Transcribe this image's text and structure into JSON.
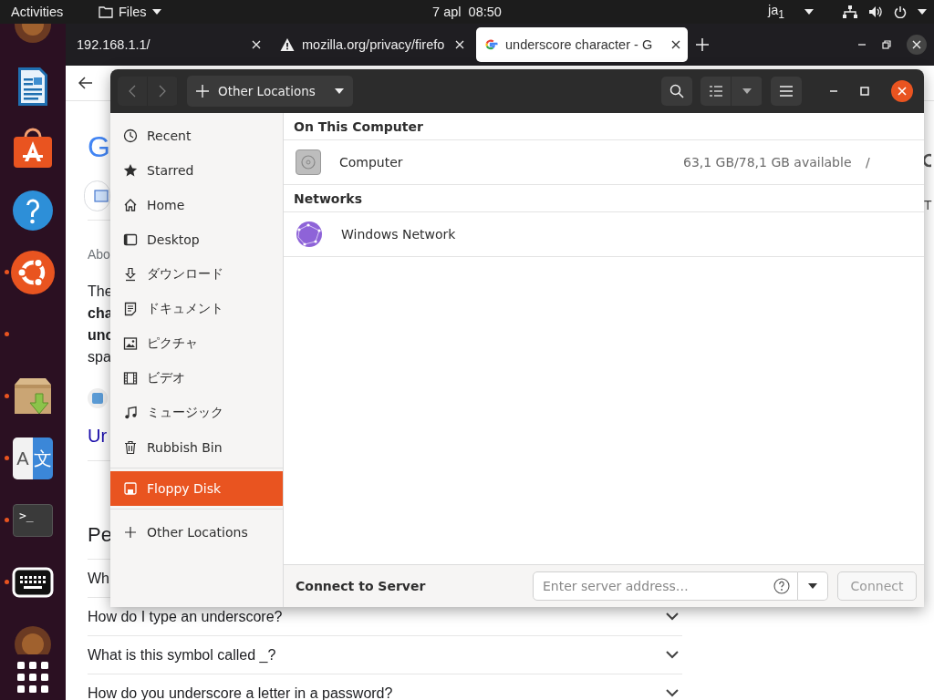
{
  "top_bar": {
    "activities": "Activities",
    "app_menu": "Files",
    "clock": "7 apl  08:50",
    "input_source": "ja$_{1}$"
  },
  "dock": {
    "items": [
      {
        "kind": "partial",
        "running": false
      },
      {
        "kind": "writer",
        "running": false
      },
      {
        "kind": "store",
        "running": false
      },
      {
        "kind": "help",
        "running": false
      },
      {
        "kind": "ubuntu",
        "running": true
      },
      {
        "kind": "empty",
        "running": true
      },
      {
        "kind": "archive",
        "running": true
      },
      {
        "kind": "translate",
        "running": true,
        "glyphs": [
          "A",
          "文"
        ]
      },
      {
        "kind": "terminal",
        "running": true,
        "glyphs": [
          ">_"
        ]
      },
      {
        "kind": "keyboard",
        "running": true
      },
      {
        "kind": "partial",
        "running": false
      }
    ]
  },
  "browser": {
    "tabs": [
      {
        "title": "192.168.1.1/",
        "kind": "plain",
        "selected": false
      },
      {
        "title": "mozilla.org/privacy/firefo",
        "kind": "warning",
        "selected": false
      },
      {
        "title": "underscore character - G",
        "kind": "google",
        "selected": true
      }
    ],
    "logo_fragment": "G",
    "about_fragment": "Abo",
    "snippet_lines": [
      {
        "text": "The",
        "bold": false
      },
      {
        "text": "cha",
        "bold": true
      },
      {
        "text": "unc",
        "bold": true
      },
      {
        "text": "spa",
        "bold": false
      }
    ],
    "link_fragment": "Ur",
    "heading_fragment": "Pe",
    "right_fragment": "T",
    "faq": [
      {
        "text": "Wh",
        "kind": "fragment"
      },
      {
        "text": "How do I type an underscore?",
        "kind": "question"
      },
      {
        "text": "What is this symbol called _?",
        "kind": "question"
      },
      {
        "text": "How do you underscore a letter in a password?",
        "kind": "question"
      }
    ]
  },
  "files": {
    "nav_buttons": [
      {
        "kind": "back",
        "disabled": true
      },
      {
        "kind": "forward",
        "disabled": true
      }
    ],
    "path": "Other Locations",
    "sidebar_sections": [
      {
        "items": [
          {
            "kind": "recent",
            "label": "Recent",
            "selected": false
          },
          {
            "kind": "starred",
            "label": "Starred",
            "selected": false
          },
          {
            "kind": "home",
            "label": "Home",
            "selected": false
          },
          {
            "kind": "desktop",
            "label": "Desktop",
            "selected": false
          },
          {
            "kind": "download",
            "label": "ダウンロード",
            "selected": false
          },
          {
            "kind": "documents",
            "label": "ドキュメント",
            "selected": false
          },
          {
            "kind": "pictures",
            "label": "ピクチャ",
            "selected": false
          },
          {
            "kind": "videos",
            "label": "ビデオ",
            "selected": false
          },
          {
            "kind": "music",
            "label": "ミュージック",
            "selected": false
          },
          {
            "kind": "trash",
            "label": "Rubbish Bin",
            "selected": false
          }
        ]
      },
      {
        "items": [
          {
            "kind": "floppy",
            "label": "Floppy Disk",
            "selected": true
          }
        ]
      },
      {
        "items": [
          {
            "kind": "other",
            "label": "Other Locations",
            "selected": false
          }
        ]
      }
    ],
    "sections": [
      {
        "title": "On This Computer",
        "rows": [
          {
            "kind": "drive",
            "name": "Computer",
            "info": "63,1 GB/78,1 GB available",
            "path": "/"
          }
        ]
      },
      {
        "title": "Networks",
        "rows": [
          {
            "kind": "network",
            "name": "Windows Network"
          }
        ]
      }
    ],
    "connect": {
      "label": "Connect to Server",
      "placeholder": "Enter server address…",
      "button": "Connect",
      "button_disabled": true
    }
  }
}
